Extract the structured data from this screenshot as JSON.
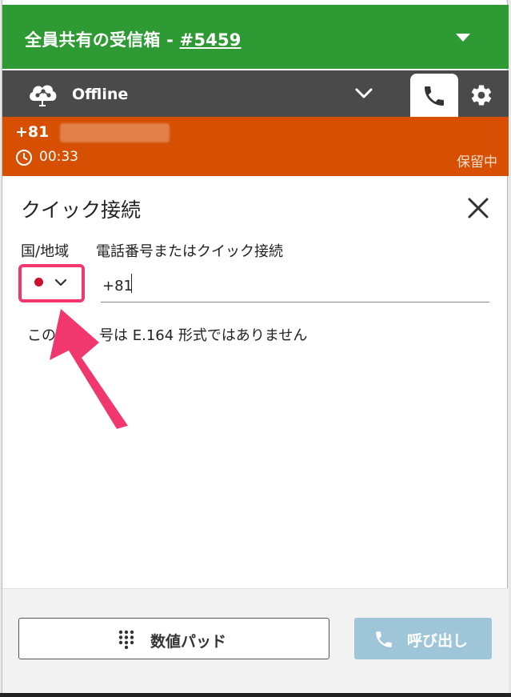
{
  "header": {
    "title_prefix": "全員共有の受信箱 - ",
    "title_link": "#5459"
  },
  "status": {
    "label": "Offline"
  },
  "call": {
    "number_prefix": "+81",
    "timer": "00:33",
    "state": "保留中"
  },
  "panel": {
    "title": "クイック接続",
    "country_label": "国/地域",
    "phone_label": "電話番号またはクイック接続",
    "phone_value": "+81",
    "error_left": "この",
    "error_right": "号は E.164 形式ではありません"
  },
  "footer": {
    "keypad_label": "数値パッド",
    "call_label": "呼び出し"
  },
  "colors": {
    "header_green": "#2e9a33",
    "status_gray": "#4a4a4a",
    "call_orange": "#d64f03",
    "highlight_pink": "#f0386e",
    "call_button_disabled": "#9fc6d8"
  },
  "icons": [
    "cloud-network-icon",
    "chevron-down-icon",
    "phone-icon",
    "gear-icon",
    "clock-icon",
    "close-icon",
    "keypad-icon",
    "annotation-arrow"
  ]
}
